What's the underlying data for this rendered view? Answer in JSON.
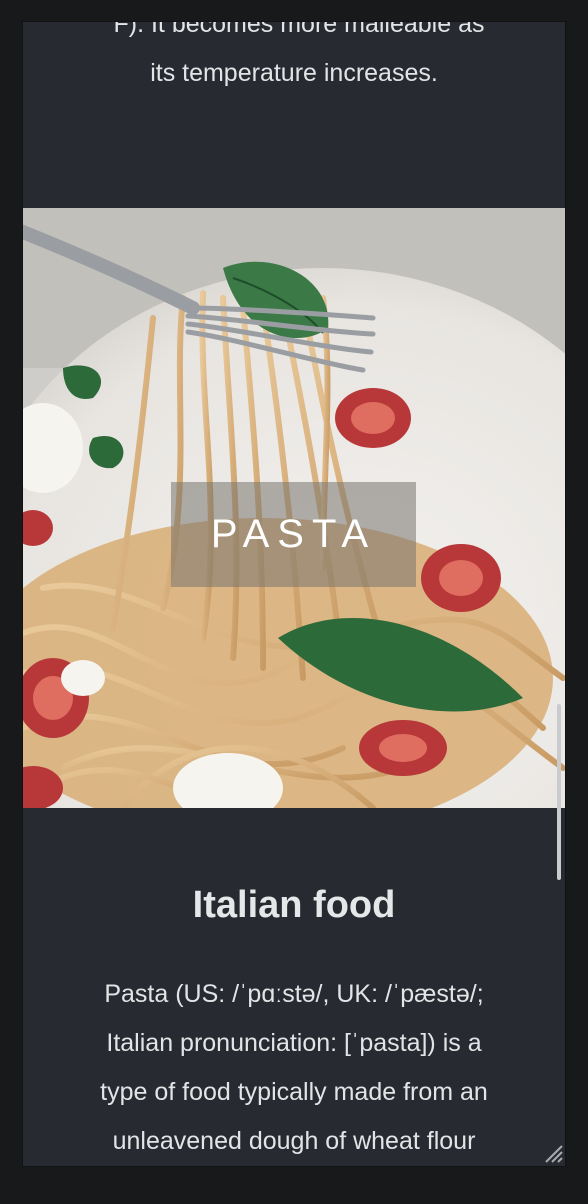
{
  "intro": {
    "line1": "°F). It becomes more malleable as",
    "line2": "its temperature increases."
  },
  "hero": {
    "label": "PASTA"
  },
  "section": {
    "title": "Italian food",
    "body_lines": [
      "Pasta (US: /ˈpɑːstə/, UK: /ˈpæstə/;",
      "Italian pronunciation: [ˈpasta]) is a",
      "type of food typically made from an",
      "unleavened dough of wheat flour"
    ]
  },
  "icons": {
    "resize": "resize-grip-icon",
    "fork": "fork-icon"
  },
  "colors": {
    "panel": "#272b31",
    "page": "#18191b",
    "text": "#e3e4e6"
  }
}
